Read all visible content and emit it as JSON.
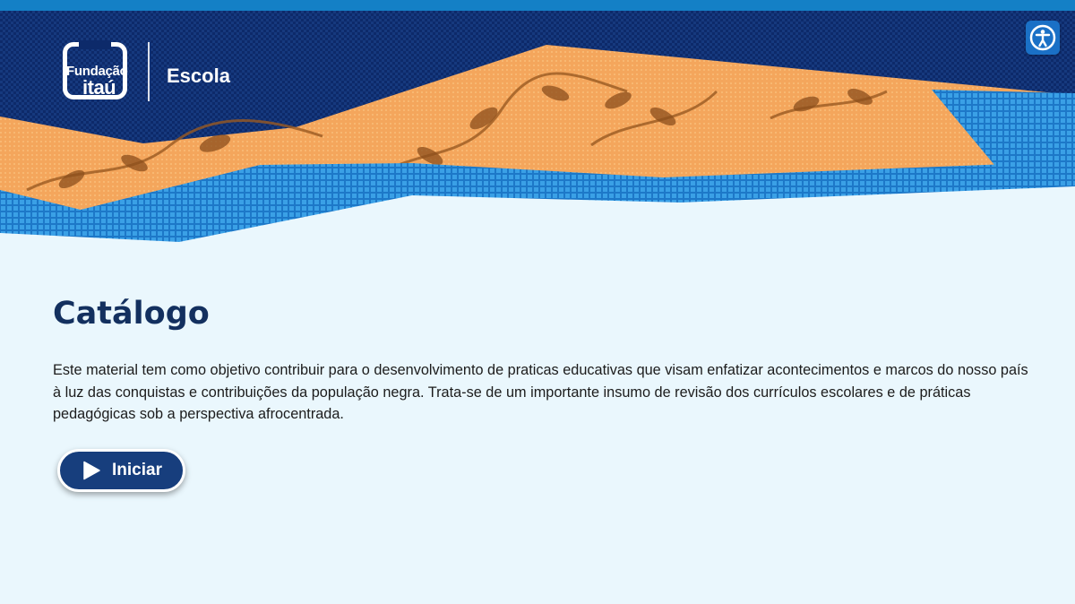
{
  "header": {
    "logo": {
      "line1": "Fundação",
      "line2": "itaú"
    },
    "product_label": "Escola",
    "accessibility_icon": "accessibility-icon"
  },
  "main": {
    "title": "Catálogo",
    "description": "Este material tem como objetivo contribuir para o desenvolvimento de praticas educativas que visam enfatizar acontecimentos e marcos do nosso país à luz das conquistas e contribuições da população negra. Trata-se de um importante insumo de revisão dos currículos escolares e de práticas pedagógicas sob a perspectiva afrocentrada.",
    "start_button": {
      "label": "Iniciar",
      "icon": "play-icon"
    }
  },
  "colors": {
    "top_strip": "#1480c6",
    "dark_fabric": "#0d2a6a",
    "orange_fabric": "#f2a55a",
    "light_blue_fabric": "#2a8fd8",
    "page_background": "#eaf7fd",
    "title": "#13305f",
    "button": "#173e7d"
  }
}
